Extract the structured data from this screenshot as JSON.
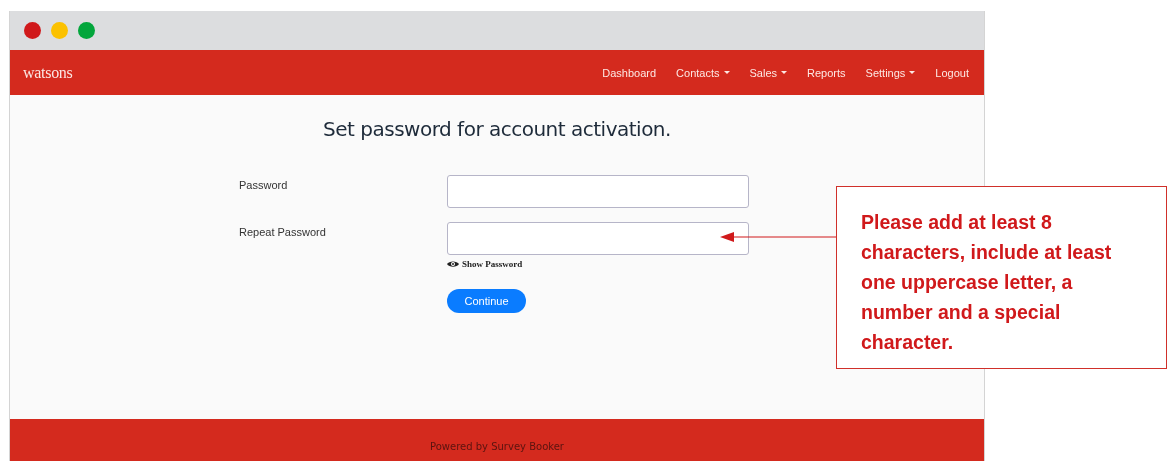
{
  "window": {
    "controls": [
      {
        "color": "#d0191b"
      },
      {
        "color": "#fbc100"
      },
      {
        "color": "#03a63c"
      }
    ]
  },
  "navbar": {
    "brand": "watsons",
    "items": [
      {
        "label": "Dashboard",
        "kind": "link"
      },
      {
        "label": "Contacts",
        "kind": "dropdown"
      },
      {
        "label": "Sales",
        "kind": "dropdown"
      },
      {
        "label": "Reports",
        "kind": "link"
      },
      {
        "label": "Settings",
        "kind": "dropdown"
      },
      {
        "label": "Logout",
        "kind": "link"
      }
    ]
  },
  "form": {
    "title": "Set password for account activation.",
    "fields": [
      {
        "label": "Password"
      },
      {
        "label": "Repeat Password"
      }
    ],
    "show_password": "Show Password",
    "submit": "Continue"
  },
  "footer": "Powered by Survey Booker",
  "callout": {
    "text": "Please add at least 8 characters, include at least one uppercase letter, a number and a special character."
  }
}
